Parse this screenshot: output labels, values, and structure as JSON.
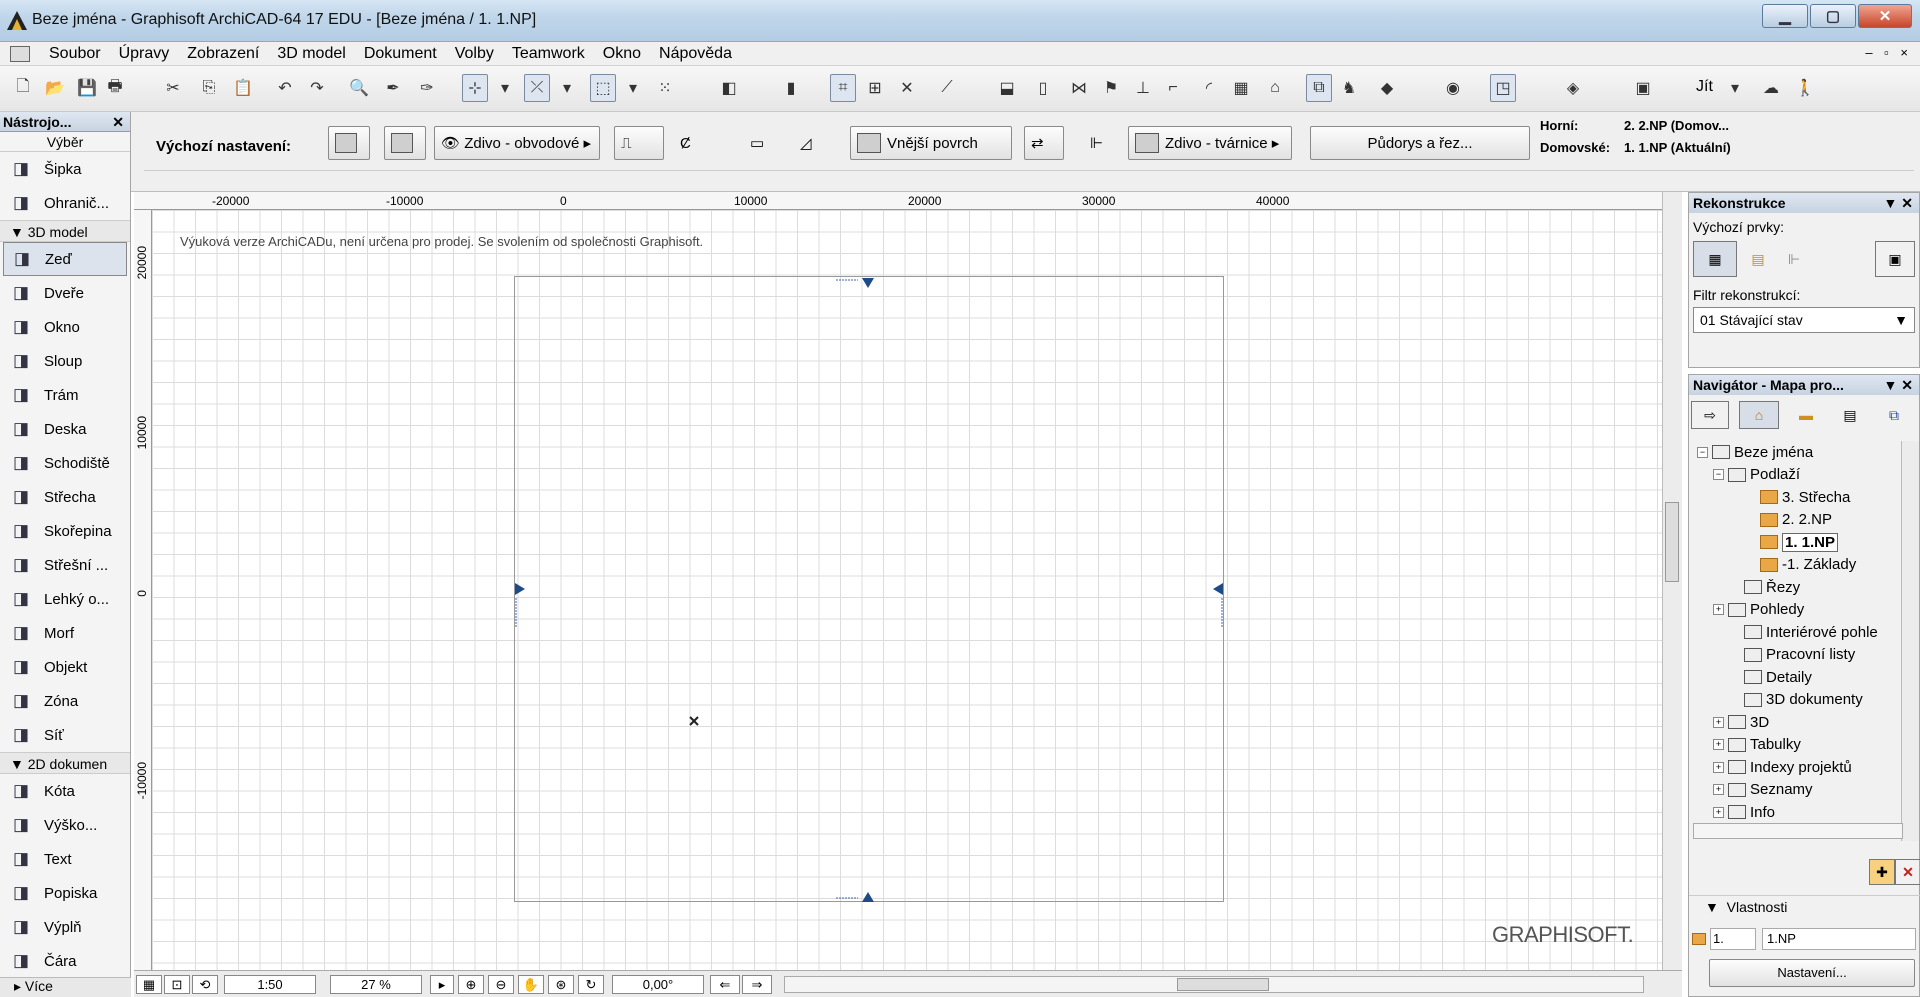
{
  "window": {
    "title": "Beze jména - Graphisoft ArchiCAD-64 17 EDU - [Beze jména / 1. 1.NP]",
    "min": "▁",
    "max": "▢",
    "close": "✕"
  },
  "menu": {
    "items": [
      "Soubor",
      "Úpravy",
      "Zobrazení",
      "3D model",
      "Dokument",
      "Volby",
      "Teamwork",
      "Okno",
      "Nápověda"
    ],
    "mdi": "– ▫ ×"
  },
  "toolbar": {
    "goto_label": "Jít"
  },
  "infobox": {
    "default_settings": "Výchozí nastavení:",
    "composite_label": "Zdivo - obvodové",
    "surface_label": "Vnější povrch",
    "fill_label": "Zdivo - tvárnice",
    "floor_plan_button": "Půdorys a řez...",
    "top_label": "Horní:",
    "top_value": "2. 2.NP (Domov...",
    "home_label": "Domovské:",
    "home_value": "1. 1.NP (Aktuální)"
  },
  "toolbox": {
    "title": "Nástrojo...",
    "select_label": "Výběr",
    "tools_top": [
      {
        "label": "Šipka",
        "icon": "arrow-icon"
      },
      {
        "label": "Ohranič...",
        "icon": "marquee-icon"
      }
    ],
    "section_3d": "3D model",
    "tools_3d": [
      {
        "label": "Zeď",
        "icon": "wall-icon"
      },
      {
        "label": "Dveře",
        "icon": "door-icon"
      },
      {
        "label": "Okno",
        "icon": "window-icon"
      },
      {
        "label": "Sloup",
        "icon": "column-icon"
      },
      {
        "label": "Trám",
        "icon": "beam-icon"
      },
      {
        "label": "Deska",
        "icon": "slab-icon"
      },
      {
        "label": "Schodiště",
        "icon": "stair-icon"
      },
      {
        "label": "Střecha",
        "icon": "roof-icon"
      },
      {
        "label": "Skořepina",
        "icon": "shell-icon"
      },
      {
        "label": "Střešní ...",
        "icon": "skylight-icon"
      },
      {
        "label": "Lehký o...",
        "icon": "curtain-wall-icon"
      },
      {
        "label": "Morf",
        "icon": "morph-icon"
      },
      {
        "label": "Objekt",
        "icon": "object-icon"
      },
      {
        "label": "Zóna",
        "icon": "zone-icon"
      },
      {
        "label": "Síť",
        "icon": "mesh-icon"
      }
    ],
    "section_2d": "2D dokumen",
    "tools_2d": [
      {
        "label": "Kóta",
        "icon": "dimension-icon"
      },
      {
        "label": "Výško...",
        "icon": "level-dimension-icon"
      },
      {
        "label": "Text",
        "icon": "text-icon"
      },
      {
        "label": "Popiska",
        "icon": "label-icon"
      },
      {
        "label": "Výplň",
        "icon": "fill-icon"
      },
      {
        "label": "Čára",
        "icon": "line-icon"
      }
    ],
    "more": "Více"
  },
  "canvas": {
    "watermark": "Výuková verze ArchiCADu, není určena pro prodej. Se svolením od společnosti Graphisoft.",
    "brand": "GRAPHISOFT.",
    "ruler_top": [
      "-20000",
      "-10000",
      "0",
      "10000",
      "20000",
      "30000",
      "40000"
    ],
    "ruler_left": [
      "20000",
      "10000",
      "0",
      "-10000"
    ]
  },
  "statusbar": {
    "scale": "1:50",
    "zoom": "27 %",
    "angle": "0,00°"
  },
  "renovation": {
    "title": "Rekonstrukce",
    "default_elements": "Výchozí prvky:",
    "filter_label": "Filtr rekonstrukcí:",
    "filter_value": "01 Stávající stav"
  },
  "navigator": {
    "title": "Navigátor - Mapa pro...",
    "nodes": [
      {
        "label": "Beze jména",
        "indent": 0,
        "exp": "−"
      },
      {
        "label": "Podlaží",
        "indent": 1,
        "exp": "−"
      },
      {
        "label": "3. Střecha",
        "indent": 3,
        "folder": true
      },
      {
        "label": "2. 2.NP",
        "indent": 3,
        "folder": true
      },
      {
        "label": "1. 1.NP",
        "indent": 3,
        "folder": true,
        "selected": true
      },
      {
        "label": "-1. Základy",
        "indent": 3,
        "folder": true
      },
      {
        "label": "Řezy",
        "indent": 2
      },
      {
        "label": "Pohledy",
        "indent": 1,
        "exp": "+"
      },
      {
        "label": "Interiérové pohle",
        "indent": 2
      },
      {
        "label": "Pracovní listy",
        "indent": 2
      },
      {
        "label": "Detaily",
        "indent": 2
      },
      {
        "label": "3D dokumenty",
        "indent": 2
      },
      {
        "label": "3D",
        "indent": 1,
        "exp": "+"
      },
      {
        "label": "Tabulky",
        "indent": 1,
        "exp": "+"
      },
      {
        "label": "Indexy projektů",
        "indent": 1,
        "exp": "+"
      },
      {
        "label": "Seznamy",
        "indent": 1,
        "exp": "+"
      },
      {
        "label": "Info",
        "indent": 1,
        "exp": "+"
      }
    ],
    "properties_label": "Vlastnosti",
    "prop_id": "1.",
    "prop_name": "1.NP",
    "settings_button": "Nastavení..."
  }
}
